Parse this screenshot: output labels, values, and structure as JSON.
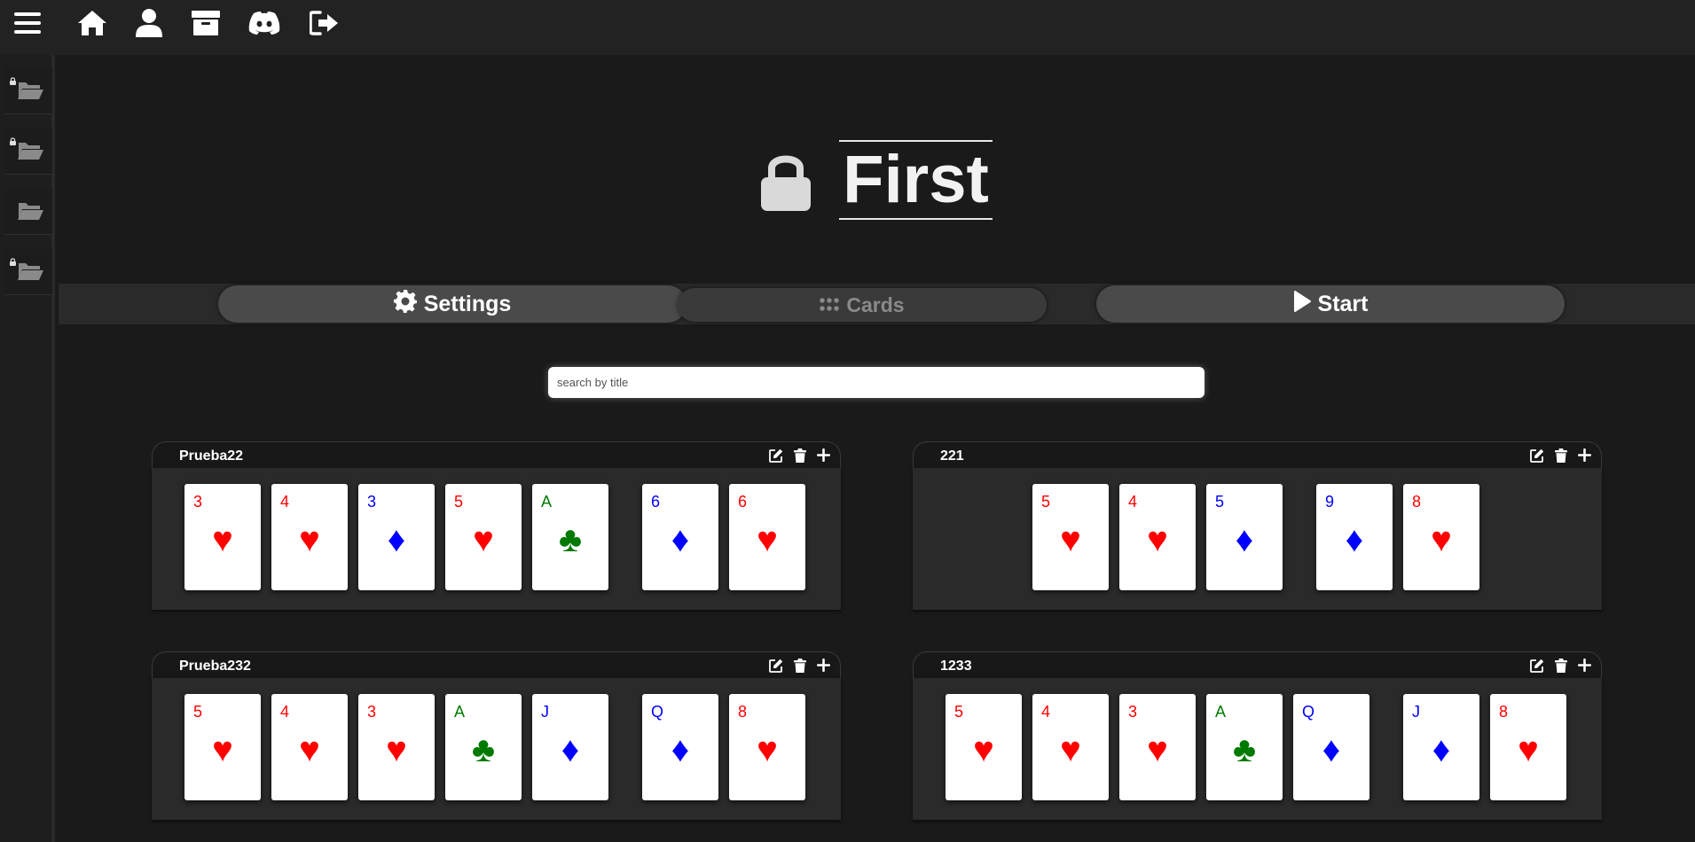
{
  "nav": {
    "icons": [
      "menu-icon",
      "home-icon",
      "user-icon",
      "archive-icon",
      "discord-icon",
      "logout-icon"
    ]
  },
  "sidebar": {
    "folders": [
      {
        "icon": "folder-icon",
        "locked": true
      },
      {
        "icon": "folder-icon",
        "locked": true
      },
      {
        "icon": "folder-icon",
        "locked": false
      },
      {
        "icon": "folder-icon",
        "locked": true
      }
    ]
  },
  "page": {
    "title": "First",
    "locked": true
  },
  "tabs": {
    "settings": "Settings",
    "cards": "Cards",
    "start": "Start"
  },
  "search": {
    "placeholder": "search by title",
    "value": ""
  },
  "decks": [
    {
      "name": "Prueba22",
      "cards": [
        {
          "rank": "3",
          "suit": "♥",
          "color": "red"
        },
        {
          "rank": "4",
          "suit": "♥",
          "color": "red"
        },
        {
          "rank": "3",
          "suit": "♦",
          "color": "blue"
        },
        {
          "rank": "5",
          "suit": "♥",
          "color": "red"
        },
        {
          "rank": "A",
          "suit": "♣",
          "color": "green"
        },
        {
          "rank": "6",
          "suit": "♦",
          "color": "blue"
        },
        {
          "rank": "6",
          "suit": "♥",
          "color": "red"
        }
      ]
    },
    {
      "name": "221",
      "cards": [
        {
          "rank": "5",
          "suit": "♥",
          "color": "red"
        },
        {
          "rank": "4",
          "suit": "♥",
          "color": "red"
        },
        {
          "rank": "5",
          "suit": "♦",
          "color": "blue"
        },
        {
          "rank": "9",
          "suit": "♦",
          "color": "blue"
        },
        {
          "rank": "8",
          "suit": "♥",
          "color": "red"
        }
      ]
    },
    {
      "name": "Prueba232",
      "cards": [
        {
          "rank": "5",
          "suit": "♥",
          "color": "red"
        },
        {
          "rank": "4",
          "suit": "♥",
          "color": "red"
        },
        {
          "rank": "3",
          "suit": "♥",
          "color": "red"
        },
        {
          "rank": "A",
          "suit": "♣",
          "color": "green"
        },
        {
          "rank": "J",
          "suit": "♦",
          "color": "blue"
        },
        {
          "rank": "Q",
          "suit": "♦",
          "color": "blue"
        },
        {
          "rank": "8",
          "suit": "♥",
          "color": "red"
        }
      ]
    },
    {
      "name": "1233",
      "cards": [
        {
          "rank": "5",
          "suit": "♥",
          "color": "red"
        },
        {
          "rank": "4",
          "suit": "♥",
          "color": "red"
        },
        {
          "rank": "3",
          "suit": "♥",
          "color": "red"
        },
        {
          "rank": "A",
          "suit": "♣",
          "color": "green"
        },
        {
          "rank": "Q",
          "suit": "♦",
          "color": "blue"
        },
        {
          "rank": "J",
          "suit": "♦",
          "color": "blue"
        },
        {
          "rank": "8",
          "suit": "♥",
          "color": "red"
        }
      ]
    }
  ],
  "colors": {
    "background": "#1a1a1a",
    "red_suit": "#ff0000",
    "blue_suit": "#0000ff",
    "green_suit": "#007a00"
  }
}
